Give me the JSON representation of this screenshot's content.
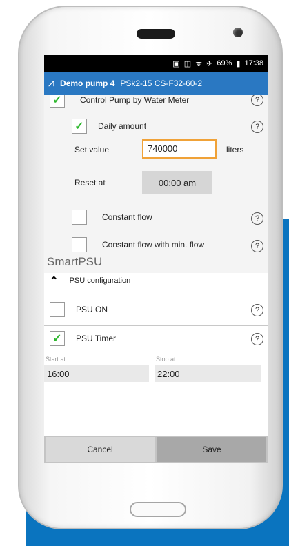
{
  "statusbar": {
    "icons": [
      "image-icon",
      "signal-icon",
      "wifi-icon",
      "airplane-icon"
    ],
    "battery": "69%",
    "time": "17:38"
  },
  "appbar": {
    "title": "Demo pump 4",
    "subtitle": "PSk2-15 CS-F32-60-2"
  },
  "pump_control": {
    "label": "Control Pump by Water Meter",
    "checked": true,
    "daily_amount": {
      "label": "Daily amount",
      "checked": true
    },
    "set_value": {
      "label": "Set value",
      "value": "740000",
      "unit": "liters"
    },
    "reset_at": {
      "label": "Reset at",
      "value": "00:00 am"
    },
    "constant_flow": {
      "label": "Constant flow",
      "checked": false
    },
    "constant_flow_min": {
      "label": "Constant flow with min. flow",
      "checked": false
    }
  },
  "smartpsu": {
    "title": "SmartPSU",
    "config_label": "PSU configuration",
    "psu_on": {
      "label": "PSU ON",
      "checked": false
    },
    "psu_timer": {
      "label": "PSU Timer",
      "checked": true
    },
    "start": {
      "label": "Start at",
      "value": "16:00"
    },
    "stop": {
      "label": "Stop at",
      "value": "22:00"
    }
  },
  "actions": {
    "cancel": "Cancel",
    "save": "Save"
  },
  "colors": {
    "accent": "#2a78c2",
    "check": "#2eb82e",
    "input_border": "#f0a238",
    "brand_bg": "#0a74bf"
  }
}
